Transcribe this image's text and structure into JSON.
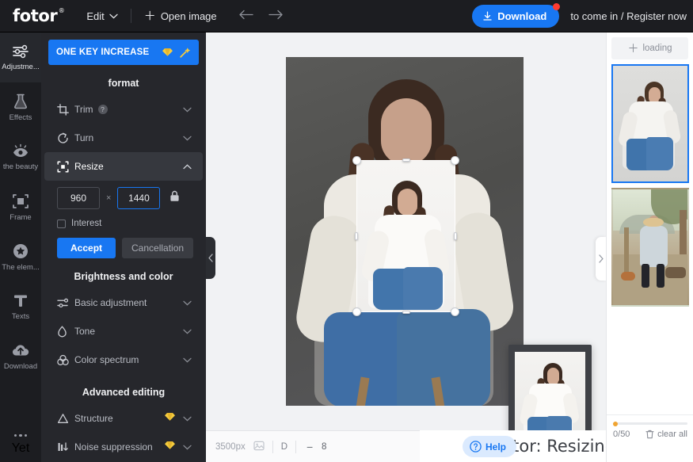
{
  "header": {
    "logo": "fotor",
    "logo_mark": "®",
    "edit_label": "Edit",
    "open_image_label": "Open image",
    "undo_icon": "arrow-left-icon",
    "redo_icon": "arrow-right-icon",
    "download_label": "Download",
    "account_label": "to come in / Register now"
  },
  "rail": {
    "items": [
      {
        "label": "Adjustme...",
        "icon": "sliders-icon",
        "active": true
      },
      {
        "label": "Effects",
        "icon": "flask-icon",
        "active": false
      },
      {
        "label": "the beauty",
        "icon": "eye-icon",
        "active": false
      },
      {
        "label": "Frame",
        "icon": "frame-icon",
        "active": false
      },
      {
        "label": "The elem...",
        "icon": "star-circle-icon",
        "active": false
      },
      {
        "label": "Texts",
        "icon": "text-t-icon",
        "active": false
      },
      {
        "label": "Download",
        "icon": "cloud-download-icon",
        "active": false
      }
    ],
    "more_label": "Yet",
    "more_icon": "ellipsis-icon"
  },
  "panel": {
    "one_key_label": "ONE KEY INCREASE",
    "one_key_gem_icon": "gem-icon",
    "one_key_wand_icon": "magic-wand-icon",
    "format_title": "format",
    "format_rows": [
      {
        "label": "Trim",
        "icon": "crop-icon",
        "help": "?",
        "chevron": "chevron-down-icon",
        "selected": false
      },
      {
        "label": "Turn",
        "icon": "rotate-icon",
        "chevron": "chevron-down-icon",
        "selected": false
      },
      {
        "label": "Resize",
        "icon": "resize-icon",
        "chevron": "chevron-up-icon",
        "selected": true
      }
    ],
    "resize": {
      "width_value": "960",
      "separator": "×",
      "height_value": "1440",
      "lock_icon": "lock-icon",
      "checkbox_label": "Interest",
      "accept_label": "Accept",
      "cancel_label": "Cancellation"
    },
    "brightness_title": "Brightness and color",
    "brightness_rows": [
      {
        "label": "Basic adjustment",
        "icon": "sliders-small-icon",
        "chevron": "chevron-down-icon"
      },
      {
        "label": "Tone",
        "icon": "droplet-icon",
        "chevron": "chevron-down-icon"
      },
      {
        "label": "Color spectrum",
        "icon": "color-circles-icon",
        "chevron": "chevron-down-icon"
      }
    ],
    "advanced_title": "Advanced editing",
    "advanced_rows": [
      {
        "label": "Structure",
        "icon": "triangle-icon",
        "gem": "gem-icon",
        "chevron": "chevron-down-icon"
      },
      {
        "label": "Noise suppression",
        "icon": "noise-bars-icon",
        "gem": "gem-icon",
        "chevron": "chevron-down-icon"
      }
    ]
  },
  "canvas": {
    "collapse_left_icon": "chevron-left-icon",
    "collapse_right_icon": "chevron-right-icon",
    "selection": {
      "handles": 8
    }
  },
  "bottombar": {
    "dimensions": "3500px",
    "image_icon": "image-icon",
    "fit_label": "D",
    "zoom_out_icon": "minus-icon",
    "zoom_value": "8",
    "help_label": "Help",
    "help_icon": "question-circle-icon"
  },
  "title_overlay": {
    "text": "Fotor: Resizing"
  },
  "right_panel": {
    "add_label": "loading",
    "add_icon": "plus-icon",
    "thumbnails": [
      {
        "name": "thumbnail-seated-woman",
        "selected": true
      },
      {
        "name": "thumbnail-outdoor-woman",
        "selected": false
      }
    ],
    "count_current": "0",
    "count_sep": "/",
    "count_max": "50",
    "clear_all_label": "clear all",
    "trash_icon": "trash-icon"
  },
  "colors": {
    "accent": "#1877f2",
    "panel_bg": "#26272c",
    "rail_bg": "#1c1d21",
    "canvas_bg": "#f1f2f4",
    "gem": "#f0c330",
    "alert_dot": "#ff3b30"
  }
}
